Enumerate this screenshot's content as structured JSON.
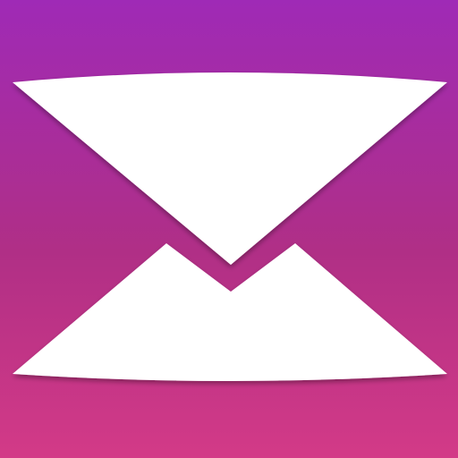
{
  "icon": {
    "name": "mail-envelope-icon",
    "gradient": {
      "top": "#9f2ab6",
      "mid": "#b02f86",
      "bottom": "#d33a87"
    },
    "foreground": "#ffffff",
    "shadow": "#7a1d5e"
  }
}
